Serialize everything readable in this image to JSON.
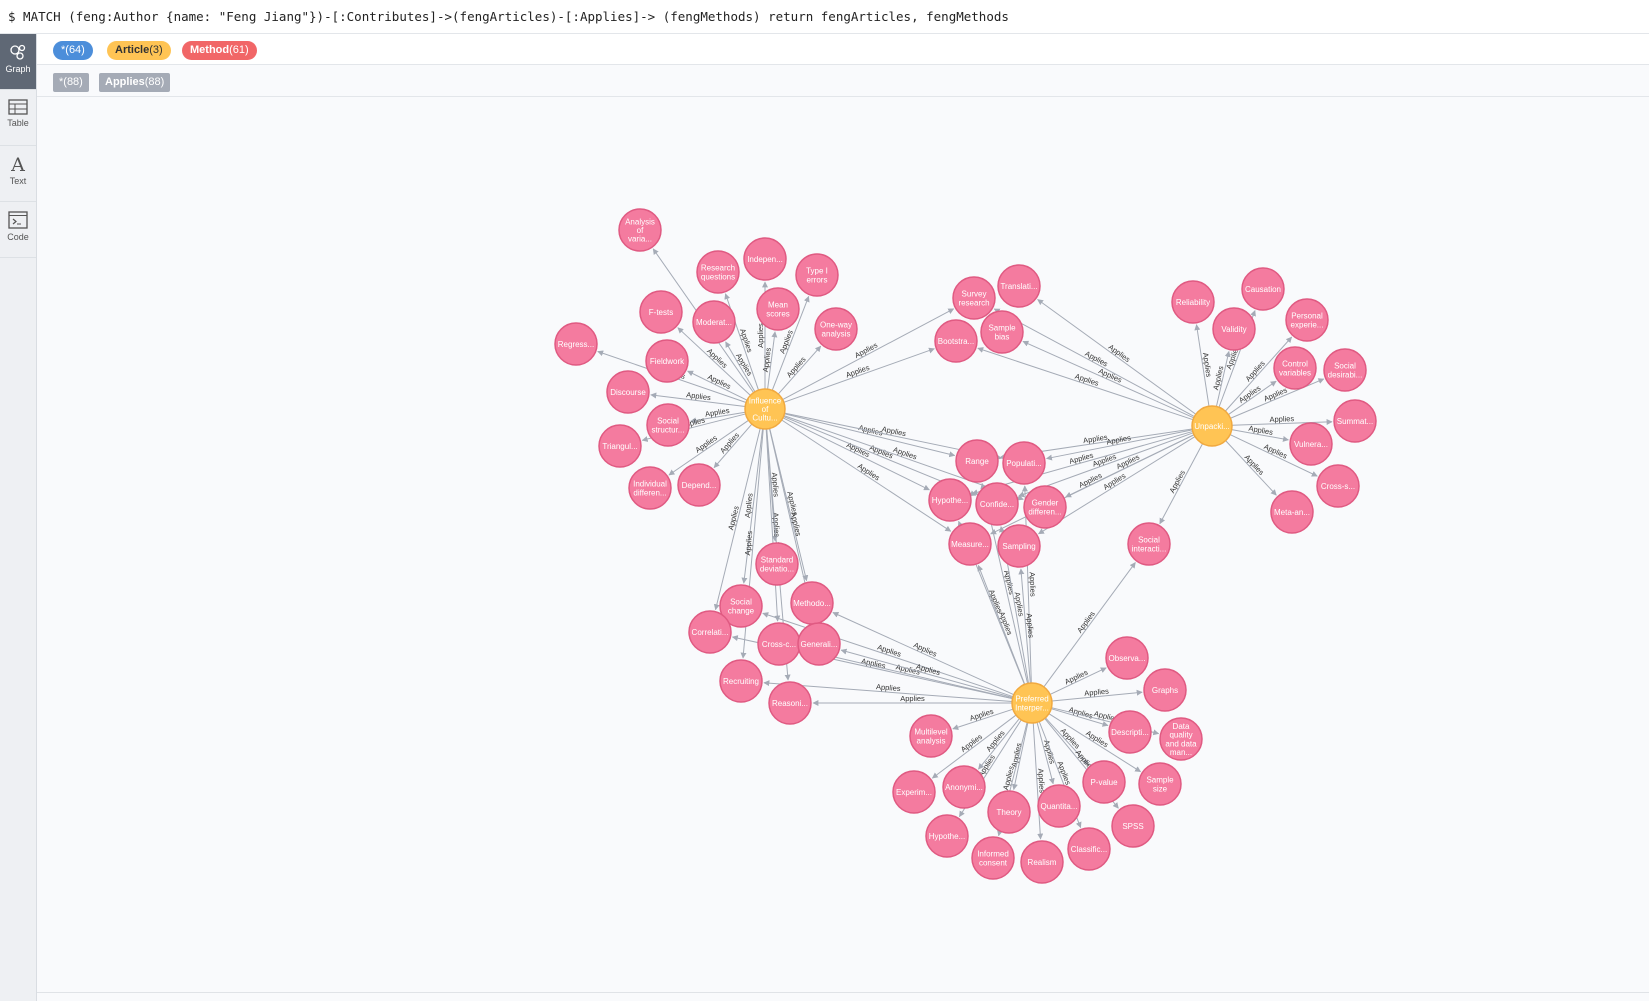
{
  "query": {
    "text": "$ MATCH (feng:Author {name: \"Feng Jiang\"})-[:Contributes]->(fengArticles)-[:Applies]-> (fengMethods) return fengArticles, fengMethods"
  },
  "sidebar": {
    "items": [
      {
        "label": "Graph",
        "icon": "graph-icon"
      },
      {
        "label": "Table",
        "icon": "table-icon"
      },
      {
        "label": "Text",
        "icon": "text-icon"
      },
      {
        "label": "Code",
        "icon": "code-icon"
      }
    ]
  },
  "legend": {
    "node_labels": [
      {
        "name": "*",
        "count": "(64)",
        "color": "#4c8eda"
      },
      {
        "name": "Article",
        "count": "(3)",
        "color": "#ffc454"
      },
      {
        "name": "Method",
        "count": "(61)",
        "color": "#f16667"
      }
    ],
    "relationship_types": [
      {
        "name": "*",
        "count": "(88)"
      },
      {
        "name": "Applies",
        "count": "(88)"
      }
    ]
  },
  "graph": {
    "colors": {
      "article": "#ffc454",
      "article_border": "#f1a93f",
      "method": "#f47b9f",
      "method_border": "#e05a82",
      "edge": "#a5abb6"
    },
    "edge_label": "Applies",
    "articles": [
      {
        "id": "A1",
        "label": "Influence of Cultu..."
      },
      {
        "id": "A2",
        "label": "Unpacki..."
      },
      {
        "id": "A3",
        "label": "Preferred Interper..."
      }
    ],
    "methods": [
      {
        "id": "M1",
        "label": "Analysis of varia..."
      },
      {
        "id": "M2",
        "label": "Research questions"
      },
      {
        "id": "M3",
        "label": "Indepen..."
      },
      {
        "id": "M4",
        "label": "Type I errors"
      },
      {
        "id": "M5",
        "label": "F-tests"
      },
      {
        "id": "M6",
        "label": "Moderat..."
      },
      {
        "id": "M7",
        "label": "Mean scores"
      },
      {
        "id": "M8",
        "label": "One-way analysis"
      },
      {
        "id": "M9",
        "label": "Regress..."
      },
      {
        "id": "M10",
        "label": "Fieldwork"
      },
      {
        "id": "M11",
        "label": "Discourse"
      },
      {
        "id": "M12",
        "label": "Social structur..."
      },
      {
        "id": "M13",
        "label": "Triangul..."
      },
      {
        "id": "M14",
        "label": "Individual differen..."
      },
      {
        "id": "M15",
        "label": "Depend..."
      },
      {
        "id": "M16",
        "label": "Survey research"
      },
      {
        "id": "M17",
        "label": "Translati..."
      },
      {
        "id": "M18",
        "label": "Bootstra..."
      },
      {
        "id": "M19",
        "label": "Sample bias"
      },
      {
        "id": "M20",
        "label": "Reliability"
      },
      {
        "id": "M21",
        "label": "Causation"
      },
      {
        "id": "M22",
        "label": "Validity"
      },
      {
        "id": "M23",
        "label": "Personal experie..."
      },
      {
        "id": "M24",
        "label": "Control variables"
      },
      {
        "id": "M25",
        "label": "Social desirabi..."
      },
      {
        "id": "M26",
        "label": "Summat..."
      },
      {
        "id": "M27",
        "label": "Vulnera..."
      },
      {
        "id": "M28",
        "label": "Cross-s..."
      },
      {
        "id": "M29",
        "label": "Meta-an..."
      },
      {
        "id": "M30",
        "label": "Range"
      },
      {
        "id": "M31",
        "label": "Populati..."
      },
      {
        "id": "M32",
        "label": "Hypothe..."
      },
      {
        "id": "M33",
        "label": "Confide..."
      },
      {
        "id": "M34",
        "label": "Gender differen..."
      },
      {
        "id": "M35",
        "label": "Measure..."
      },
      {
        "id": "M36",
        "label": "Sampling"
      },
      {
        "id": "M37",
        "label": "Social interacti..."
      },
      {
        "id": "M38",
        "label": "Standard deviatio..."
      },
      {
        "id": "M39",
        "label": "Social change"
      },
      {
        "id": "M40",
        "label": "Methodo..."
      },
      {
        "id": "M41",
        "label": "Correlati..."
      },
      {
        "id": "M42",
        "label": "Cross-c..."
      },
      {
        "id": "M43",
        "label": "Generali..."
      },
      {
        "id": "M44",
        "label": "Recruiting"
      },
      {
        "id": "M45",
        "label": "Reasoni..."
      },
      {
        "id": "M46",
        "label": "Observa..."
      },
      {
        "id": "M47",
        "label": "Graphs"
      },
      {
        "id": "M48",
        "label": "Multilevel analysis"
      },
      {
        "id": "M49",
        "label": "Descripti..."
      },
      {
        "id": "M50",
        "label": "Data quality and data man..."
      },
      {
        "id": "M51",
        "label": "P-value"
      },
      {
        "id": "M52",
        "label": "Sample size"
      },
      {
        "id": "M53",
        "label": "Experim..."
      },
      {
        "id": "M54",
        "label": "Anonymi..."
      },
      {
        "id": "M55",
        "label": "Theory"
      },
      {
        "id": "M56",
        "label": "Quantita..."
      },
      {
        "id": "M57",
        "label": "SPSS"
      },
      {
        "id": "M58",
        "label": "Hypothe..."
      },
      {
        "id": "M59",
        "label": "Informed consent"
      },
      {
        "id": "M60",
        "label": "Realism"
      },
      {
        "id": "M61",
        "label": "Classific..."
      }
    ],
    "edges": [
      [
        "A1",
        "M1"
      ],
      [
        "A1",
        "M2"
      ],
      [
        "A1",
        "M3"
      ],
      [
        "A1",
        "M4"
      ],
      [
        "A1",
        "M5"
      ],
      [
        "A1",
        "M6"
      ],
      [
        "A1",
        "M7"
      ],
      [
        "A1",
        "M8"
      ],
      [
        "A1",
        "M9"
      ],
      [
        "A1",
        "M10"
      ],
      [
        "A1",
        "M11"
      ],
      [
        "A1",
        "M12"
      ],
      [
        "A1",
        "M13"
      ],
      [
        "A1",
        "M14"
      ],
      [
        "A1",
        "M15"
      ],
      [
        "A1",
        "M16"
      ],
      [
        "A1",
        "M18"
      ],
      [
        "A1",
        "M30"
      ],
      [
        "A1",
        "M31"
      ],
      [
        "A1",
        "M32"
      ],
      [
        "A1",
        "M33"
      ],
      [
        "A1",
        "M34"
      ],
      [
        "A1",
        "M35"
      ],
      [
        "A1",
        "M38"
      ],
      [
        "A1",
        "M39"
      ],
      [
        "A1",
        "M40"
      ],
      [
        "A1",
        "M41"
      ],
      [
        "A1",
        "M42"
      ],
      [
        "A1",
        "M43"
      ],
      [
        "A1",
        "M44"
      ],
      [
        "A1",
        "M45"
      ],
      [
        "A2",
        "M16"
      ],
      [
        "A2",
        "M17"
      ],
      [
        "A2",
        "M18"
      ],
      [
        "A2",
        "M19"
      ],
      [
        "A2",
        "M20"
      ],
      [
        "A2",
        "M21"
      ],
      [
        "A2",
        "M22"
      ],
      [
        "A2",
        "M23"
      ],
      [
        "A2",
        "M24"
      ],
      [
        "A2",
        "M25"
      ],
      [
        "A2",
        "M26"
      ],
      [
        "A2",
        "M27"
      ],
      [
        "A2",
        "M28"
      ],
      [
        "A2",
        "M29"
      ],
      [
        "A2",
        "M30"
      ],
      [
        "A2",
        "M31"
      ],
      [
        "A2",
        "M32"
      ],
      [
        "A2",
        "M33"
      ],
      [
        "A2",
        "M34"
      ],
      [
        "A2",
        "M35"
      ],
      [
        "A2",
        "M36"
      ],
      [
        "A2",
        "M37"
      ],
      [
        "A3",
        "M30"
      ],
      [
        "A3",
        "M31"
      ],
      [
        "A3",
        "M32"
      ],
      [
        "A3",
        "M33"
      ],
      [
        "A3",
        "M35"
      ],
      [
        "A3",
        "M36"
      ],
      [
        "A3",
        "M37"
      ],
      [
        "A3",
        "M39"
      ],
      [
        "A3",
        "M40"
      ],
      [
        "A3",
        "M41"
      ],
      [
        "A3",
        "M42"
      ],
      [
        "A3",
        "M43"
      ],
      [
        "A3",
        "M44"
      ],
      [
        "A3",
        "M45"
      ],
      [
        "A3",
        "M46"
      ],
      [
        "A3",
        "M47"
      ],
      [
        "A3",
        "M48"
      ],
      [
        "A3",
        "M49"
      ],
      [
        "A3",
        "M50"
      ],
      [
        "A3",
        "M51"
      ],
      [
        "A3",
        "M52"
      ],
      [
        "A3",
        "M53"
      ],
      [
        "A3",
        "M54"
      ],
      [
        "A3",
        "M55"
      ],
      [
        "A3",
        "M56"
      ],
      [
        "A3",
        "M57"
      ],
      [
        "A3",
        "M58"
      ],
      [
        "A3",
        "M59"
      ],
      [
        "A3",
        "M60"
      ],
      [
        "A3",
        "M61"
      ]
    ]
  }
}
